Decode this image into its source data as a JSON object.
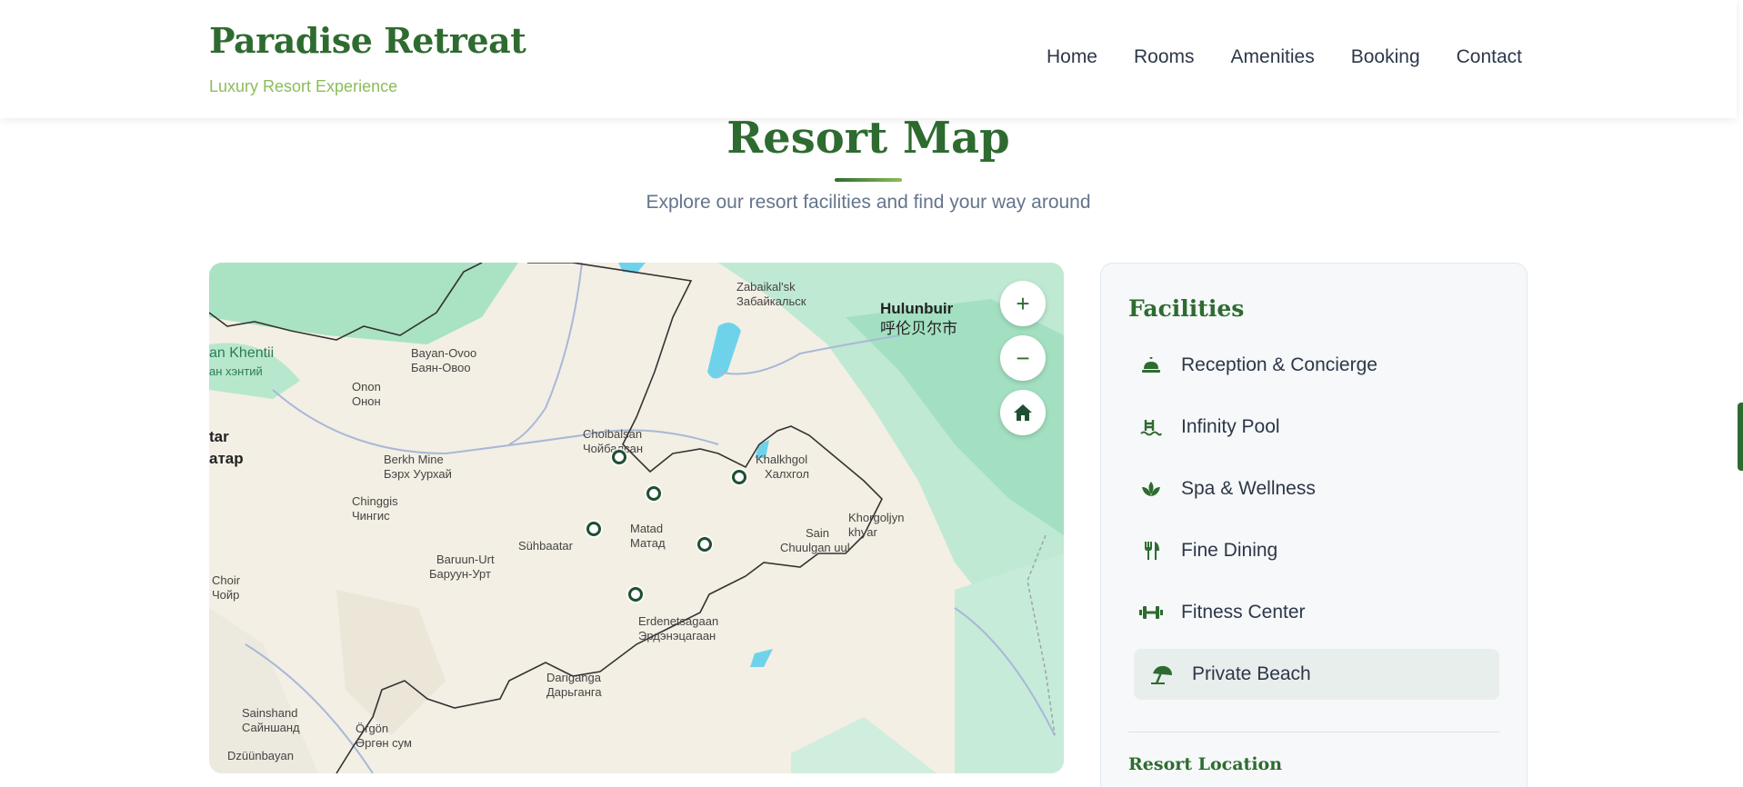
{
  "header": {
    "brand": "Paradise Retreat",
    "tagline": "Luxury Resort Experience",
    "nav": [
      "Home",
      "Rooms",
      "Amenities",
      "Booking",
      "Contact"
    ]
  },
  "section": {
    "title": "Resort Map",
    "subtitle": "Explore our resort facilities and find your way around"
  },
  "map": {
    "controls": {
      "zoom_in": "+",
      "zoom_out": "−"
    },
    "labels": {
      "zabaikalsk": "Zabaikal'sk",
      "zabaikalsk_cy": "Забайкальск",
      "hulunbuir": "Hulunbuir",
      "hulunbuir_cn": "呼伦贝尔市",
      "khentii": "an Khentii",
      "khentii_cy": "ан хэнтий",
      "bayanovoo": "Bayan-Ovoo",
      "bayanovoo_cy": "Баян-Овоо",
      "onon": "Onon",
      "onon_cy": "Онон",
      "choibalsan": "Choibalsan",
      "choibalsan_cy": "Чойбалсан",
      "tar": "tar",
      "tar_cy": "атар",
      "berkh": "Berkh Mine",
      "berkh_cy": "Бэрх Уурхай",
      "khalkhgol": "Khalkhgol",
      "khalkhgol_cy": "Халхгол",
      "chinggis": "Chinggis",
      "chinggis_cy": "Чингис",
      "matad": "Matad",
      "matad_cy": "Матад",
      "khorgoljyn": "Khorgoljyn",
      "khorgoljyn_2": "khyar",
      "sain": "Sain",
      "chuulgan": "Chuulgan uul",
      "suhbaatar": "Sühbaatar",
      "baruunurt": "Baruun-Urt",
      "baruunurt_cy": "Баруун-Урт",
      "choir": "Choir",
      "choir_cy": "Чойр",
      "erdenetsagaan": "Erdenetsagaan",
      "erdenetsagaan_cy": "Эрдэнэцагаан",
      "dariganga": "Dariganga",
      "dariganga_cy": "Дарьганга",
      "sainshand": "Sainshand",
      "sainshand_cy": "Сайншанд",
      "orgon": "Örgön",
      "orgon_cy": "Өргөн сум",
      "dzuunbayan": "Dzüünbayan"
    }
  },
  "facilities": {
    "title": "Facilities",
    "items": [
      {
        "label": "Reception & Concierge",
        "icon": "concierge-bell-icon"
      },
      {
        "label": "Infinity Pool",
        "icon": "swimming-pool-icon"
      },
      {
        "label": "Spa & Wellness",
        "icon": "spa-lotus-icon"
      },
      {
        "label": "Fine Dining",
        "icon": "utensils-icon"
      },
      {
        "label": "Fitness Center",
        "icon": "dumbbell-icon"
      },
      {
        "label": "Private Beach",
        "icon": "beach-umbrella-icon",
        "active": true
      }
    ],
    "location_title": "Resort Location"
  },
  "colors": {
    "brand_green": "#2e6b30",
    "accent_green": "#8bbd5a",
    "pin": "#1f4f32"
  }
}
